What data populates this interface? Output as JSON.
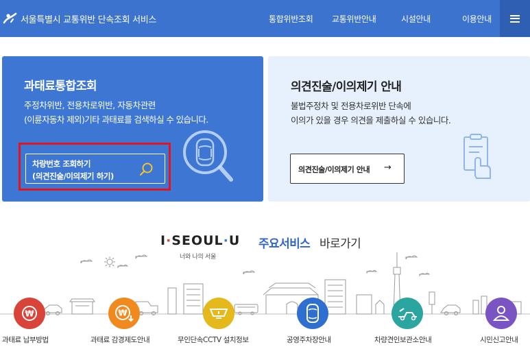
{
  "header": {
    "site_title": "서울특별시 교통위반 단속조회 서비스",
    "nav": [
      {
        "label": "통합위반조회"
      },
      {
        "label": "교통위반안내"
      },
      {
        "label": "시설안내"
      },
      {
        "label": "이용안내"
      }
    ],
    "menu_icon": "hamburger-icon"
  },
  "fine_card": {
    "title": "과태료통합조회",
    "desc_line1": "주정차위반, 전용차로위반, 자동차관련",
    "desc_line2": "(이륜자동차 제외)기타 과태료를 검색하실 수 있습니다.",
    "button_line1": "차량번호 조회하기",
    "button_line2": "(의견진술/이의제기 하기)",
    "button_icon": "search-icon",
    "illustration_icon": "car-search-icon",
    "highlight_color": "#e3141b",
    "bg_color": "#3d77d3"
  },
  "opinion_card": {
    "title": "의견진술/이의제기 안내",
    "desc_line1": "불법주정차 및 전용차로위반 단속에",
    "desc_line2": "이의가 있을 경우 의견을 제출하실 수 있습니다.",
    "button_label": "의견진술/이의제기 안내",
    "button_arrow": "→",
    "illustration_icon": "clipboard-hand-icon",
    "bg_color": "#e6f1fd"
  },
  "brand": {
    "logo_text_parts": [
      "I",
      "·",
      "SEOUL",
      "·",
      "U"
    ],
    "tagline": "너와 나의 서울",
    "section_title_bold": "주요서비스",
    "section_title_rest": " 바로가기"
  },
  "services": [
    {
      "label": "과태료 납부방법",
      "icon": "won-coin-icon",
      "color": "#d9443a"
    },
    {
      "label": "과태료 감경제도안내",
      "icon": "won-discount-icon",
      "color": "#f08a1e"
    },
    {
      "label": "무인단속CCTV 설치정보",
      "icon": "cctv-icon",
      "color": "#e5b81c"
    },
    {
      "label": "공영주차장안내",
      "icon": "car-top-icon",
      "color": "#2f6fd0"
    },
    {
      "label": "차량견인보관소안내",
      "icon": "tow-truck-icon",
      "color": "#2aa5a0"
    },
    {
      "label": "시민신고안내",
      "icon": "person-icon",
      "color": "#7b54c4"
    }
  ]
}
